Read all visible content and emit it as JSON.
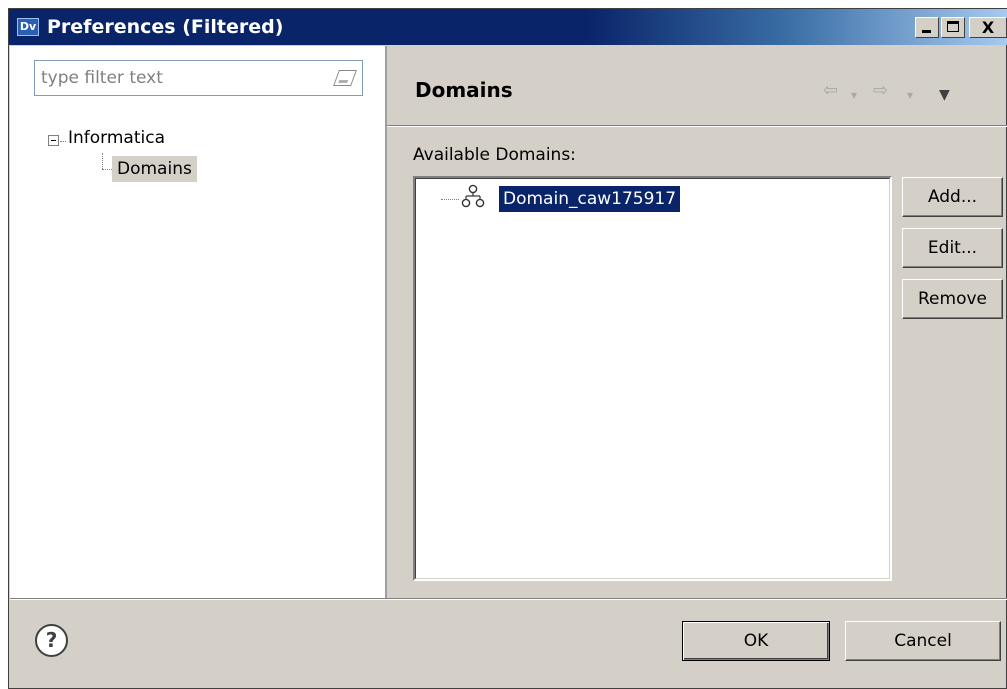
{
  "window": {
    "app_icon_text": "Dv",
    "title": "Preferences (Filtered)",
    "controls": {
      "minimize": "",
      "maximize": "",
      "close": "X"
    }
  },
  "sidebar": {
    "filter_placeholder": "type filter text",
    "filter_value": "",
    "tree": {
      "root": {
        "label": "Informatica",
        "expanded": true
      },
      "children": [
        {
          "label": "Domains",
          "selected": true
        }
      ]
    }
  },
  "page": {
    "title": "Domains",
    "nav": {
      "back": "⇦",
      "back_dropdown": "▾",
      "forward": "⇨",
      "forward_dropdown": "▾",
      "menu": "▼"
    },
    "available_label": "Available Domains:",
    "domains": [
      {
        "name": "Domain_caw175917",
        "selected": true
      }
    ],
    "buttons": {
      "add": "Add...",
      "edit": "Edit...",
      "remove": "Remove"
    }
  },
  "footer": {
    "help": "?",
    "ok": "OK",
    "cancel": "Cancel"
  },
  "colors": {
    "title_bar": "#0a246a",
    "selection": "#0a246a",
    "dialog_bg": "#d4d0c8"
  }
}
